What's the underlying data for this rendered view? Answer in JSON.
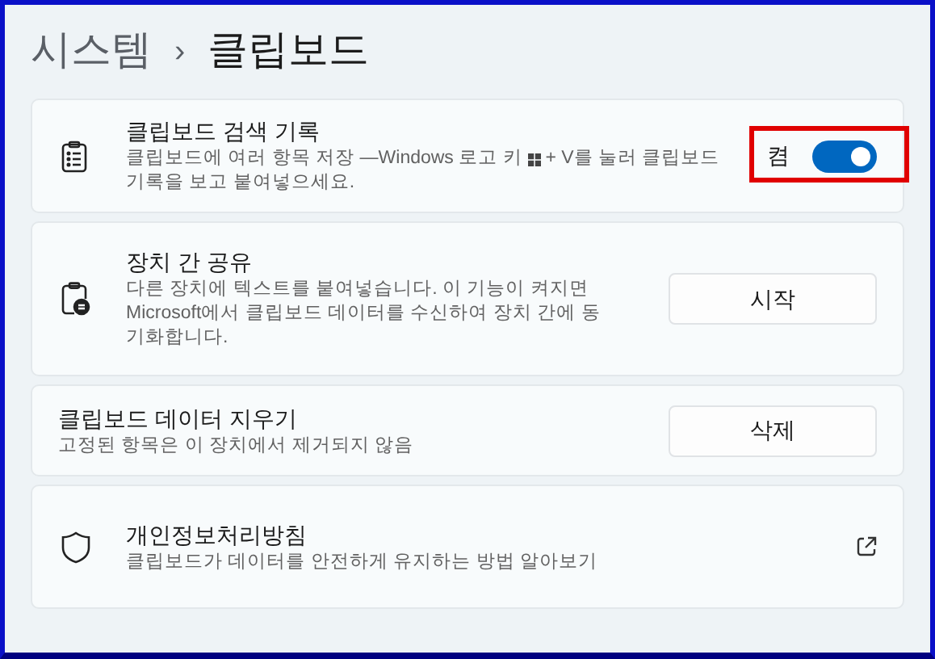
{
  "breadcrumb": {
    "parent": "시스템",
    "separator": "›",
    "current": "클립보드"
  },
  "settings": [
    {
      "kind": "toggle",
      "title": "클립보드 검색 기록",
      "description_before": "클립보드에 여러 항목 저장 —Windows 로고 키",
      "description_after": "+ V를 눌러 클립보드",
      "description_continued": "기록을 보고 붙여넣으세요.",
      "state_label": "켬",
      "on": true,
      "highlighted": true
    },
    {
      "kind": "button",
      "title": "장치 간 공유",
      "description": "다른 장치에 텍스트를 붙여넣습니다. 이 기능이 켜지면 Microsoft에서 클립보드 데이터를 수신하여 장치 간에 동기화합니다.",
      "button": "시작",
      "highlighted": false
    },
    {
      "kind": "button",
      "title": "클립보드 데이터 지우기",
      "description": "고정된 항목은 이 장치에서 제거되지 않음",
      "button": "삭제",
      "highlighted": false
    },
    {
      "kind": "link",
      "title": "개인정보처리방침",
      "description": "클립보드가 데이터를 안전하게 유지하는 방법 알아보기",
      "highlighted": false
    }
  ]
}
